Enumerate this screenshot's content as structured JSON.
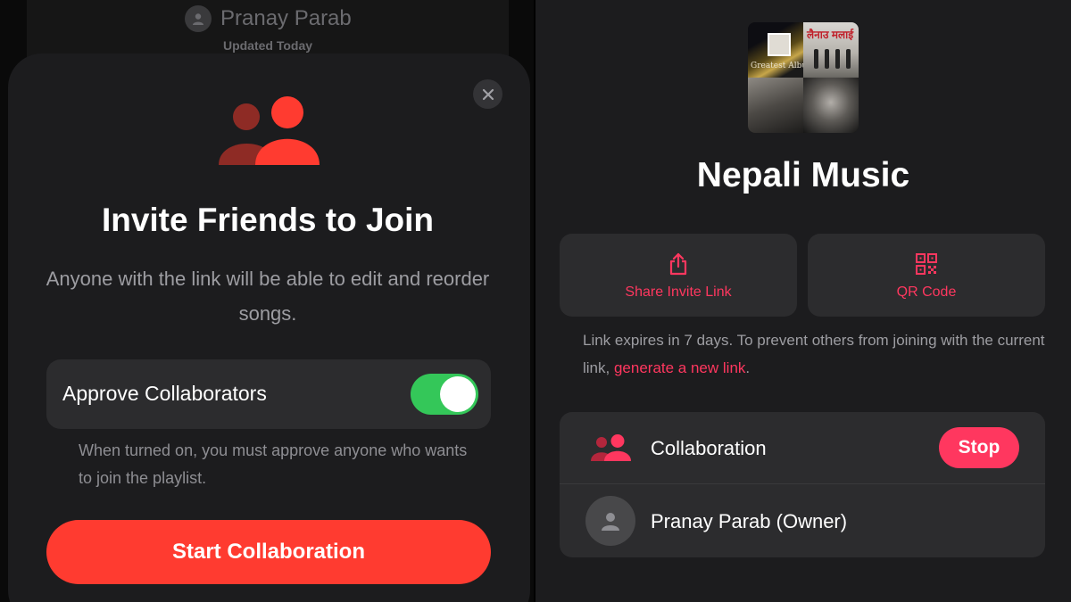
{
  "left": {
    "background_owner_name": "Pranay Parab",
    "background_updated": "Updated Today",
    "close_icon": "xmark-icon",
    "hero_icon": "two-people-icon",
    "title": "Invite Friends to Join",
    "description": "Anyone with the link will be able to edit and reorder songs.",
    "approve_label": "Approve Collaborators",
    "approve_toggle_on": true,
    "approve_note": "When turned on, you must approve anyone who wants to join the playlist.",
    "start_button": "Start Collaboration"
  },
  "right": {
    "artwork": {
      "tile_1_caption": "Greatest Album",
      "tile_2_caption": "लैनाउ मलाई"
    },
    "playlist_title": "Nepali Music",
    "share": {
      "label": "Share Invite Link",
      "icon": "share-icon"
    },
    "qr": {
      "label": "QR Code",
      "icon": "qr-code-icon"
    },
    "expiry_text": "Link expires in 7 days. To prevent others from joining with the current link, ",
    "expiry_link": "generate a new link",
    "expiry_end": ".",
    "collaboration_label": "Collaboration",
    "stop_button": "Stop",
    "owner_name": "Pranay Parab (Owner)"
  },
  "colors": {
    "accent_red": "#ff3b30",
    "accent_pink": "#ff375f",
    "toggle_green": "#34c759",
    "card_bg": "#2c2c2e",
    "sheet_bg": "#1c1c1e"
  }
}
